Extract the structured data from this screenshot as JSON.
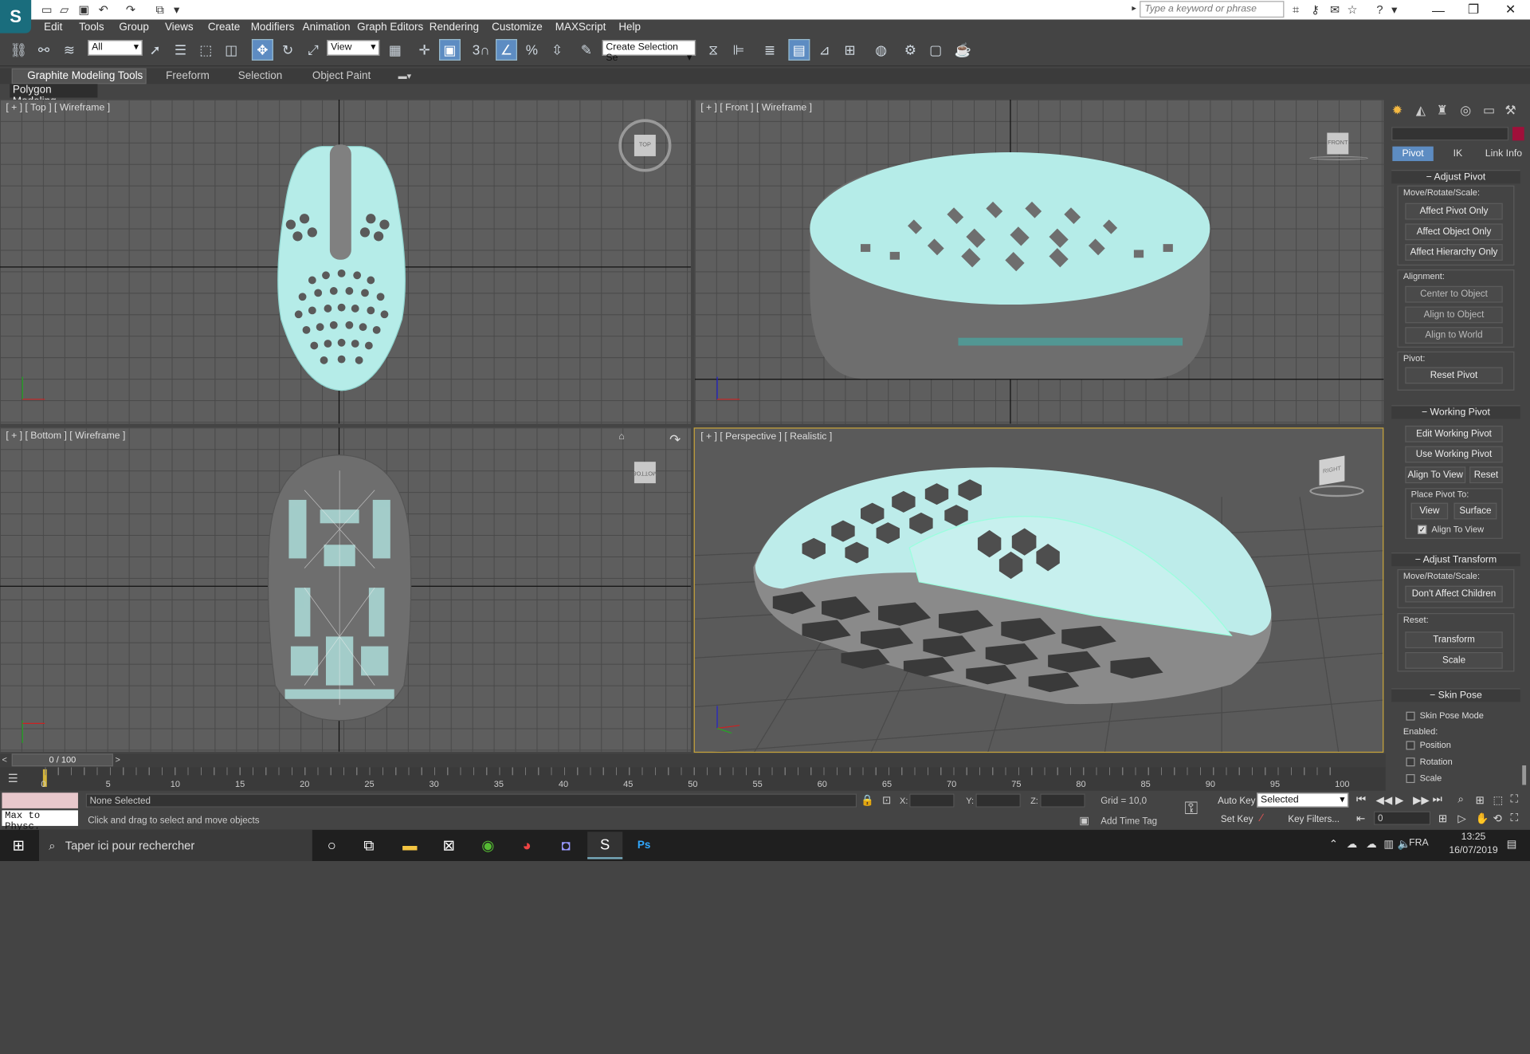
{
  "title_bar": {
    "search_placeholder": "Type a keyword or phrase",
    "quick_access": [
      "new-icon",
      "open-icon",
      "save-icon",
      "undo-icon",
      "redo-icon",
      "project-icon"
    ]
  },
  "menu": [
    "Edit",
    "Tools",
    "Group",
    "Views",
    "Create",
    "Modifiers",
    "Animation",
    "Graph Editors",
    "Rendering",
    "Customize",
    "MAXScript",
    "Help"
  ],
  "toolbar": {
    "selection_filter": "All",
    "ref_coord": "View",
    "named_selection": "Create Selection Se",
    "snap_3": "3",
    "angle_pct": "%"
  },
  "ribbon": {
    "tabs": [
      "Graphite Modeling Tools",
      "Freeform",
      "Selection",
      "Object Paint"
    ],
    "active_tab": "Graphite Modeling Tools",
    "panel_label": "Polygon Modeling"
  },
  "viewports": {
    "top": {
      "label": "[ + ] [ Top ] [ Wireframe ]",
      "cube": "TOP"
    },
    "front": {
      "label": "[ + ] [ Front ] [ Wireframe ]",
      "cube": "FRONT"
    },
    "bottom": {
      "label": "[ + ] [ Bottom ] [ Wireframe ]",
      "cube": "BOTTOM"
    },
    "perspective": {
      "label": "[ + ] [ Perspective ] [ Realistic ]",
      "cube": "RIGHT"
    }
  },
  "colors": {
    "mesh_cyan": "#b5ece8",
    "mesh_grey": "#6e6e6e",
    "active_border": "#c8a43a",
    "accent": "#5d8cc2"
  },
  "command_panel": {
    "tabs": [
      "Pivot",
      "IK",
      "Link Info"
    ],
    "active_tab": "Pivot",
    "adjust_pivot": {
      "title": "Adjust Pivot",
      "move_label": "Move/Rotate/Scale:",
      "buttons": [
        "Affect Pivot Only",
        "Affect Object Only",
        "Affect Hierarchy Only"
      ],
      "alignment_label": "Alignment:",
      "alignment_buttons": [
        "Center to Object",
        "Align to Object",
        "Align to World"
      ],
      "pivot_label": "Pivot:",
      "reset_pivot": "Reset Pivot"
    },
    "working_pivot": {
      "title": "Working Pivot",
      "buttons": [
        "Edit Working Pivot",
        "Use Working Pivot"
      ],
      "align_to_view": "Align To View",
      "reset": "Reset",
      "place_label": "Place Pivot To:",
      "view": "View",
      "surface": "Surface",
      "align_checkbox": "Align To View"
    },
    "adjust_transform": {
      "title": "Adjust Transform",
      "move_label": "Move/Rotate/Scale:",
      "dont_affect": "Don't Affect Children",
      "reset_label": "Reset:",
      "transform": "Transform",
      "scale": "Scale"
    },
    "skin_pose": {
      "title": "Skin Pose",
      "mode": "Skin Pose Mode",
      "enabled_label": "Enabled:",
      "options": [
        "Position",
        "Rotation",
        "Scale"
      ]
    }
  },
  "timeline": {
    "frame": "0 / 100",
    "ticks": [
      "0",
      "5",
      "10",
      "15",
      "20",
      "25",
      "30",
      "35",
      "40",
      "45",
      "50",
      "55",
      "60",
      "65",
      "70",
      "75",
      "80",
      "85",
      "90",
      "95",
      "100"
    ]
  },
  "status": {
    "script_listener": "Max to Physc.",
    "selection": "None Selected",
    "prompt": "Click and drag to select and move objects",
    "x_label": "X:",
    "y_label": "Y:",
    "z_label": "Z:",
    "grid": "Grid = 10,0",
    "add_time_tag": "Add Time Tag",
    "auto_key": "Auto Key",
    "set_key": "Set Key",
    "key_mode": "Selected",
    "key_filters": "Key Filters...",
    "current_frame": "0"
  },
  "taskbar": {
    "search": "Taper ici pour rechercher",
    "lang": "FRA",
    "time": "13:25",
    "date": "16/07/2019",
    "apps": [
      "cortana-icon",
      "task-view-icon",
      "file-explorer-icon",
      "store-icon",
      "xbox-icon",
      "chrome-icon",
      "discord-icon",
      "3dsmax-icon",
      "photoshop-icon"
    ]
  }
}
